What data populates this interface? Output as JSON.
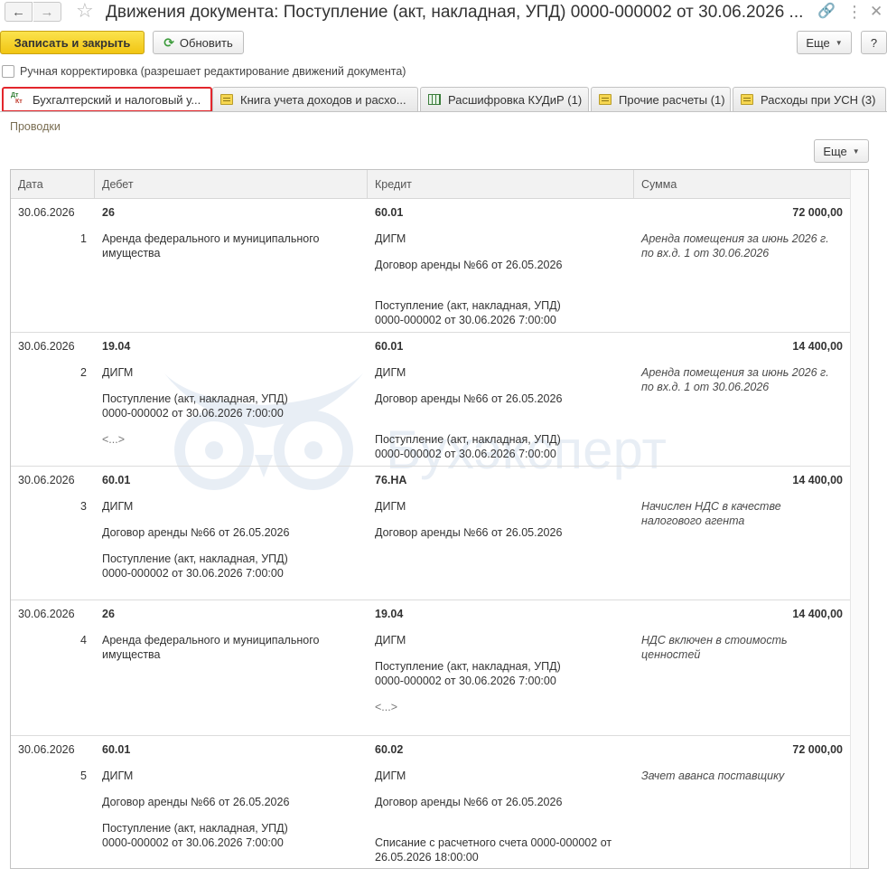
{
  "window": {
    "title": "Движения документа: Поступление (акт, накладная, УПД) 0000-000002 от 30.06.2026 ..."
  },
  "toolbar": {
    "save_close_label": "Записать и закрыть",
    "refresh_label": "Обновить",
    "more_label": "Еще",
    "help_label": "?"
  },
  "manual_correction": {
    "label": "Ручная корректировка (разрешает редактирование движений документа)",
    "checked": false
  },
  "tabs": [
    {
      "label": "Бухгалтерский и налоговый у...",
      "icon": "dt-kt-icon",
      "active": true
    },
    {
      "label": "Книга учета доходов и расхо...",
      "icon": "register-icon",
      "active": false
    },
    {
      "label": "Расшифровка КУДиР (1)",
      "icon": "grid-icon",
      "active": false
    },
    {
      "label": "Прочие расчеты (1)",
      "icon": "register-icon",
      "active": false
    },
    {
      "label": "Расходы при УСН (3)",
      "icon": "register-icon",
      "active": false
    }
  ],
  "section": {
    "label": "Проводки",
    "more_label": "Еще"
  },
  "grid": {
    "columns": [
      "Дата",
      "Дебет",
      "Кредит",
      "Сумма"
    ],
    "rows": [
      {
        "date": "30.06.2026",
        "num": "1",
        "debit_account": "26",
        "debit_lines": [
          "Аренда федерального и муниципального\nимущества"
        ],
        "credit_account": "60.01",
        "credit_lines": [
          "ДИГМ",
          "Договор аренды №66 от 26.05.2026",
          "Поступление (акт, накладная, УПД)\n0000-000002 от 30.06.2026 7:00:00"
        ],
        "amount": "72 000,00",
        "description": "Аренда помещения за июнь 2026 г.\nпо вх.д. 1 от 30.06.2026"
      },
      {
        "date": "30.06.2026",
        "num": "2",
        "debit_account": "19.04",
        "debit_lines": [
          "ДИГМ",
          "Поступление (акт, накладная, УПД)\n0000-000002 от 30.06.2026 7:00:00",
          "<...>"
        ],
        "credit_account": "60.01",
        "credit_lines": [
          "ДИГМ",
          "Договор аренды №66 от 26.05.2026",
          "Поступление (акт, накладная, УПД)\n0000-000002 от 30.06.2026 7:00:00"
        ],
        "amount": "14 400,00",
        "description": "Аренда помещения за июнь 2026 г.\nпо вх.д. 1 от 30.06.2026"
      },
      {
        "date": "30.06.2026",
        "num": "3",
        "debit_account": "60.01",
        "debit_lines": [
          "ДИГМ",
          "Договор аренды №66 от 26.05.2026",
          "Поступление (акт, накладная, УПД)\n0000-000002 от 30.06.2026 7:00:00"
        ],
        "credit_account": "76.НА",
        "credit_lines": [
          "ДИГМ",
          "Договор аренды №66 от 26.05.2026"
        ],
        "amount": "14 400,00",
        "description": "Начислен НДС в качестве\nналогового агента"
      },
      {
        "date": "30.06.2026",
        "num": "4",
        "debit_account": "26",
        "debit_lines": [
          "Аренда федерального и муниципального\nимущества"
        ],
        "credit_account": "19.04",
        "credit_lines": [
          "ДИГМ",
          "Поступление (акт, накладная, УПД)\n0000-000002 от 30.06.2026 7:00:00",
          "<...>"
        ],
        "amount": "14 400,00",
        "description": "НДС включен в стоимость\nценностей"
      },
      {
        "date": "30.06.2026",
        "num": "5",
        "debit_account": "60.01",
        "debit_lines": [
          "ДИГМ",
          "Договор аренды №66 от 26.05.2026",
          "Поступление (акт, накладная, УПД)\n0000-000002 от 30.06.2026 7:00:00"
        ],
        "credit_account": "60.02",
        "credit_lines": [
          "ДИГМ",
          "Договор аренды №66 от 26.05.2026",
          "Списание с расчетного счета 0000-000002 от\n26.05.2026 18:00:00"
        ],
        "amount": "72 000,00",
        "description": "Зачет аванса поставщику"
      }
    ]
  },
  "watermark": {
    "text": "Бухэксперт"
  },
  "colors": {
    "primary_button": "#f1c513",
    "active_tab_border": "#e3262c",
    "section_label": "#7a6e53"
  }
}
